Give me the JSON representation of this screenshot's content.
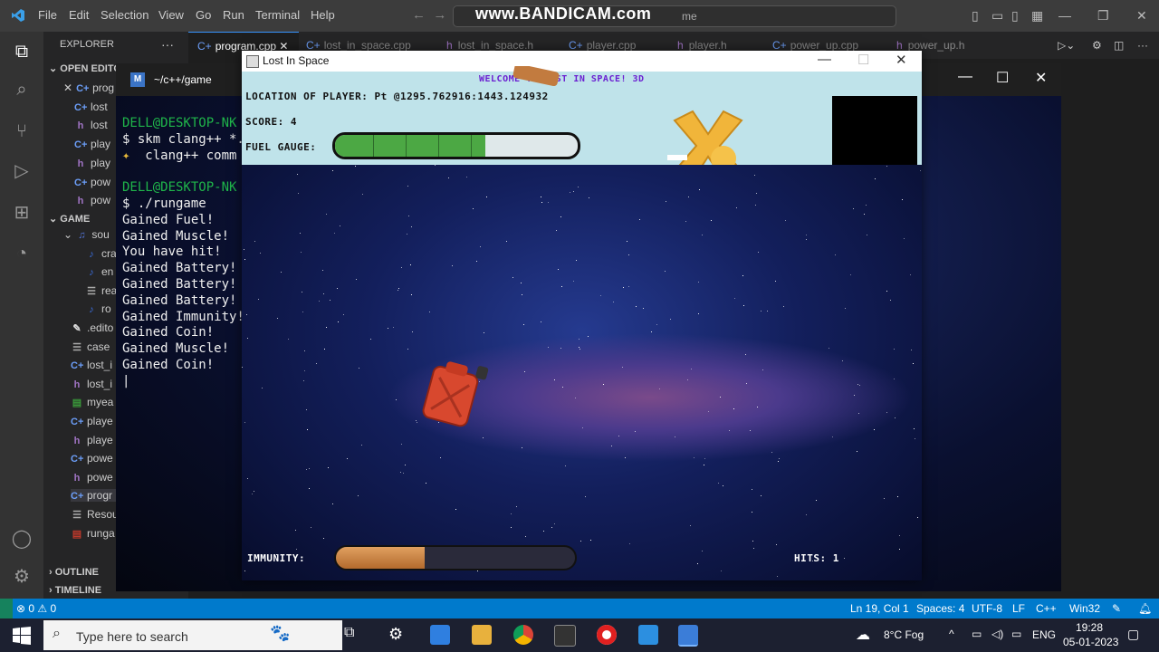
{
  "vscode": {
    "menu": [
      "File",
      "Edit",
      "Selection",
      "View",
      "Go",
      "Run",
      "Terminal",
      "Help"
    ],
    "search_overlay": "www.BANDICAM.com",
    "search_suffix": "me",
    "sidebar": {
      "explorer_title": "EXPLORER",
      "open_editors": "OPEN EDITO",
      "open_items": [
        "prog",
        "lost",
        "lost",
        "play",
        "play",
        "pow",
        "pow"
      ],
      "game_section": "GAME",
      "game_items": [
        "sou",
        "cra",
        "en",
        "rea",
        "ro",
        ".edito",
        "case",
        "lost_i",
        "lost_i",
        "myea",
        "playe",
        "playe",
        "powe",
        "powe",
        "progr",
        "Resou",
        "runga"
      ],
      "outline": "OUTLINE",
      "timeline": "TIMELINE"
    },
    "tabs": [
      "program.cpp",
      "lost_in_space.cpp",
      "lost_in_space.h",
      "player.cpp",
      "player.h",
      "power_up.cpp",
      "power_up.h"
    ],
    "status": {
      "problems": "⊗ 0 ⚠ 0",
      "position": "Ln 19, Col 1",
      "spaces": "Spaces: 4",
      "encoding": "UTF-8",
      "eol": "LF",
      "language": "C++",
      "platform": "Win32"
    }
  },
  "terminal": {
    "title": "~/c++/game",
    "icon_letter": "M",
    "prompt1": "DELL@DESKTOP-NK",
    "cmd1": "$ skm clang++ *.",
    "cmd1_out": "  clang++ comm",
    "prompt2": "DELL@DESKTOP-NK",
    "cmd2": "$ ./rungame",
    "output": [
      "Gained Fuel!",
      "Gained Muscle!",
      "You have hit!",
      "Gained Battery!",
      "Gained Battery!",
      "Gained Battery!",
      "Gained Immunity!",
      "Gained Coin!",
      "Gained Muscle!",
      "Gained Coin!"
    ]
  },
  "game": {
    "window_title": "Lost In Space",
    "welcome": "WELCOME TO LOST IN SPACE! 3D",
    "location": "LOCATION OF PLAYER: Pt @1295.762916:1443.124932",
    "score": "SCORE: 4",
    "fuel_label": "FUEL GAUGE:",
    "fuel_level": 0.62,
    "immunity_label": "IMMUNITY:",
    "immunity_level": 0.37,
    "hits": "HITS: 1",
    "colors": {
      "hud_bg": "#bfe3ea",
      "fuel": "#4ca844",
      "immunity": "#c47a3a",
      "welcome": "#6b1fd1"
    }
  },
  "taskbar": {
    "search_placeholder": "Type here to search",
    "weather": "8°C  Fog",
    "lang": "ENG",
    "time": "19:28",
    "date": "05-01-2023"
  }
}
